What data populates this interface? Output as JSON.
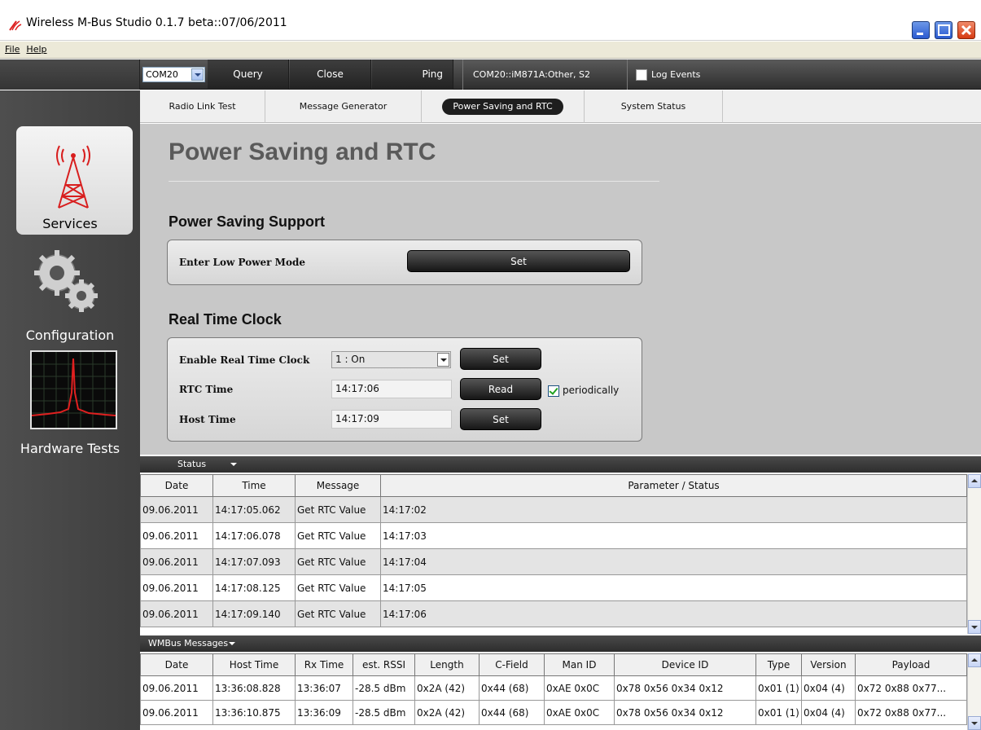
{
  "window": {
    "title": "Wireless M-Bus Studio  0.1.7 beta::07/06/2011"
  },
  "menu": {
    "file": "File",
    "help": "Help"
  },
  "toolbar": {
    "port": "COM20",
    "query": "Query",
    "close": "Close",
    "ping": "Ping",
    "connection": "COM20::iM871A:Other, S2",
    "log_events": "Log Events"
  },
  "tabs": [
    "Radio Link Test",
    "Message Generator",
    "Power Saving and RTC",
    "System Status"
  ],
  "sidebar": [
    "Services",
    "Configuration",
    "Hardware Tests"
  ],
  "page": {
    "title": "Power Saving and RTC",
    "power_section": "Power Saving Support",
    "low_power_label": "Enter Low Power Mode",
    "low_power_button": "Set",
    "rtc_section": "Real Time Clock",
    "enable_rtc_label": "Enable Real Time Clock",
    "enable_rtc_value": "1 : On",
    "enable_rtc_button": "Set",
    "rtc_time_label": "RTC Time",
    "rtc_time_value": "14:17:06",
    "rtc_read_button": "Read",
    "periodically": "periodically",
    "host_time_label": "Host Time",
    "host_time_value": "14:17:09",
    "host_time_button": "Set"
  },
  "status": {
    "header": "Status",
    "columns": [
      "Date",
      "Time",
      "Message",
      "Parameter / Status"
    ],
    "rows": [
      [
        "09.06.2011",
        "14:17:05.062",
        "Get RTC Value",
        "14:17:02"
      ],
      [
        "09.06.2011",
        "14:17:06.078",
        "Get RTC Value",
        "14:17:03"
      ],
      [
        "09.06.2011",
        "14:17:07.093",
        "Get RTC Value",
        "14:17:04"
      ],
      [
        "09.06.2011",
        "14:17:08.125",
        "Get RTC Value",
        "14:17:05"
      ],
      [
        "09.06.2011",
        "14:17:09.140",
        "Get RTC Value",
        "14:17:06"
      ]
    ]
  },
  "wmbus": {
    "header": "WMBus Messages",
    "columns": [
      "Date",
      "Host Time",
      "Rx Time",
      "est. RSSI",
      "Length",
      "C-Field",
      "Man ID",
      "Device ID",
      "Type",
      "Version",
      "Payload"
    ],
    "rows": [
      [
        "09.06.2011",
        "13:36:08.828",
        "13:36:07",
        "-28.5 dBm",
        "0x2A (42)",
        "0x44 (68)",
        "0xAE 0x0C",
        "0x78 0x56 0x34 0x12",
        "0x01 (1)",
        "0x04 (4)",
        "0x72 0x88 0x77..."
      ],
      [
        "09.06.2011",
        "13:36:10.875",
        "13:36:09",
        "-28.5 dBm",
        "0x2A (42)",
        "0x44 (68)",
        "0xAE 0x0C",
        "0x78 0x56 0x34 0x12",
        "0x01 (1)",
        "0x04 (4)",
        "0x72 0x88 0x77..."
      ]
    ]
  }
}
